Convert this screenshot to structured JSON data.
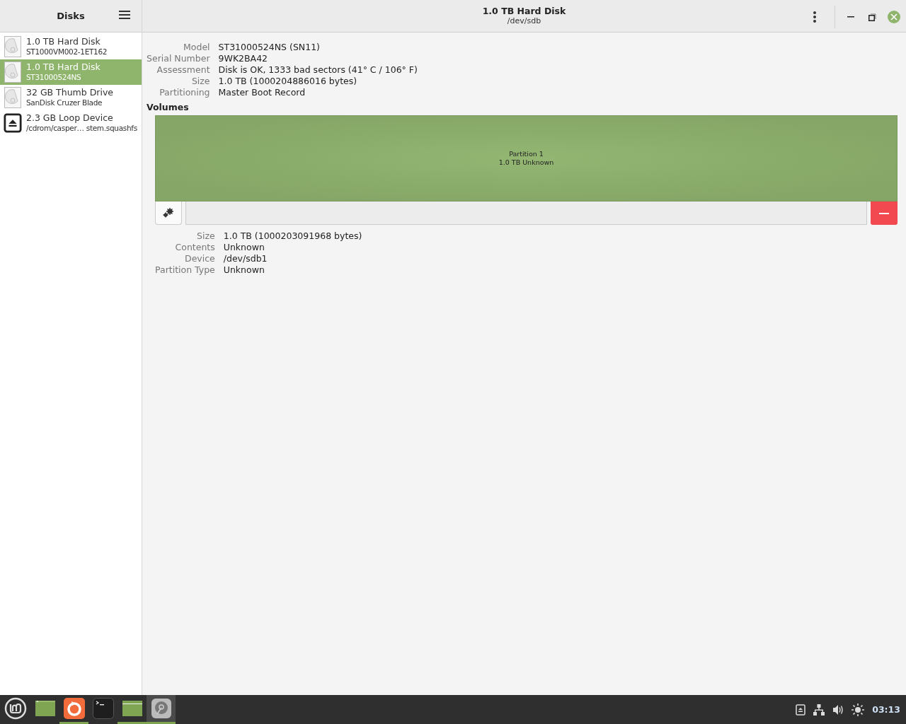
{
  "sidebar": {
    "title": "Disks",
    "items": [
      {
        "kind": "hdd",
        "name": "1.0 TB Hard Disk",
        "detail": "ST1000VM002-1ET162",
        "selected": false
      },
      {
        "kind": "hdd",
        "name": "1.0 TB Hard Disk",
        "detail": "ST31000524NS",
        "selected": true
      },
      {
        "kind": "hdd",
        "name": "32 GB Thumb Drive",
        "detail": "SanDisk Cruzer Blade",
        "selected": false
      },
      {
        "kind": "loop",
        "name": "2.3 GB Loop Device",
        "detail": "/cdrom/casper… stem.squashfs",
        "selected": false
      }
    ]
  },
  "window": {
    "title": "1.0 TB Hard Disk",
    "subtitle": "/dev/sdb"
  },
  "disk_properties": [
    {
      "label": "Model",
      "value": "ST31000524NS (SN11)"
    },
    {
      "label": "Serial Number",
      "value": "9WK2BA42"
    },
    {
      "label": "Assessment",
      "value": "Disk is OK, 1333 bad sectors (41° C / 106° F)"
    },
    {
      "label": "Size",
      "value": "1.0 TB (1000204886016 bytes)"
    },
    {
      "label": "Partitioning",
      "value": "Master Boot Record"
    }
  ],
  "volumes": {
    "heading": "Volumes",
    "partitions": [
      {
        "name": "Partition 1",
        "detail": "1.0 TB Unknown",
        "selected": true
      }
    ],
    "properties": [
      {
        "label": "Size",
        "value": "1.0 TB (1000203091968 bytes)"
      },
      {
        "label": "Contents",
        "value": "Unknown"
      },
      {
        "label": "Device",
        "value": "/dev/sdb1"
      },
      {
        "label": "Partition Type",
        "value": "Unknown"
      }
    ]
  },
  "taskbar": {
    "items": [
      {
        "kind": "desktop",
        "running": false,
        "selected": false
      },
      {
        "kind": "browser",
        "running": true,
        "selected": false
      },
      {
        "kind": "terminal",
        "running": false,
        "selected": false
      },
      {
        "kind": "files",
        "running": true,
        "selected": false
      },
      {
        "kind": "disks",
        "running": true,
        "selected": true
      }
    ],
    "clock": "03:13"
  }
}
